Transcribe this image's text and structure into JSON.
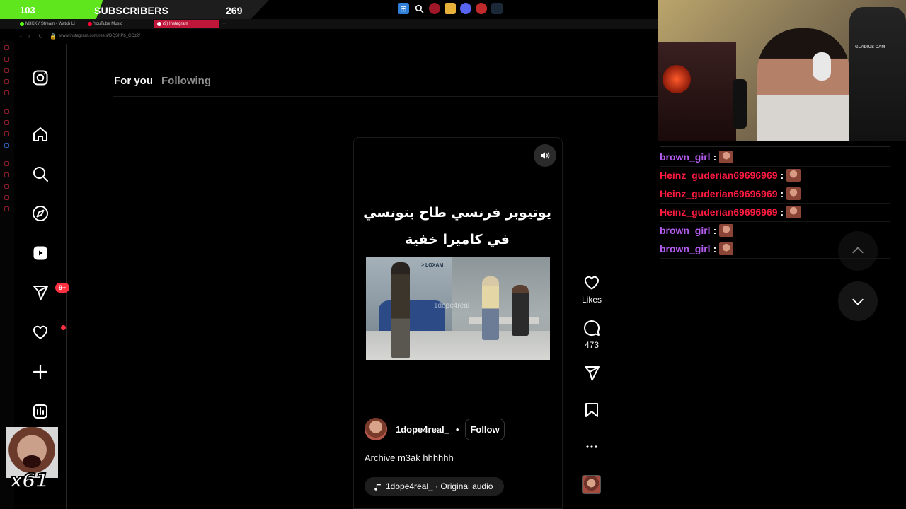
{
  "stream_overlay": {
    "subscribers": {
      "current": "103",
      "label": "SUBSCRIBERS",
      "goal": "269",
      "progress_fraction": 0.383
    },
    "emote_combo": "x61"
  },
  "browser": {
    "tabs": [
      {
        "label": "M3KKY Stream - Watch Li",
        "color": "#53fc18"
      },
      {
        "label": "YouTube Music",
        "color": "#ff0033"
      },
      {
        "label": "(9) Instagram",
        "color": "#ffffff",
        "active": true
      }
    ],
    "url": "www.instagram.com/reels/DQShPb_COz2/"
  },
  "instagram": {
    "nav": {
      "items": [
        {
          "name": "instagram-logo-icon"
        },
        {
          "name": "home-icon"
        },
        {
          "name": "search-icon"
        },
        {
          "name": "explore-icon"
        },
        {
          "name": "reels-icon"
        },
        {
          "name": "messages-icon"
        },
        {
          "name": "notifications-icon"
        },
        {
          "name": "create-icon"
        },
        {
          "name": "dashboard-icon"
        }
      ],
      "messages_badge": "9+"
    },
    "tabs": {
      "for_you": "For you",
      "following": "Following"
    },
    "reel": {
      "caption_line1": "يوتيوبر فرنسي طاح بتونسي",
      "caption_line2": "في كاميرا خفية",
      "watermark": "1dope4real",
      "truck_brand": "> LOXAM",
      "author": "1dope4real_",
      "separator": "•",
      "follow_label": "Follow",
      "description": "Archive m3ak hhhhhh",
      "audio": "1dope4real_ · Original audio",
      "likes_label": "Likes",
      "comments_count": "473"
    }
  },
  "chat": {
    "messages": [
      {
        "user": "brown_girl",
        "color": "#b45cf0"
      },
      {
        "user": "Heinz_guderian69696969",
        "color": "#ff1a40"
      },
      {
        "user": "Heinz_guderian69696969",
        "color": "#ff1a40"
      },
      {
        "user": "Heinz_guderian69696969",
        "color": "#ff1a40"
      },
      {
        "user": "brown_girl",
        "color": "#b45cf0"
      },
      {
        "user": "brown_girl",
        "color": "#b45cf0"
      }
    ],
    "separator": ":"
  },
  "webcam": {
    "chair_label": "GLADIUS CAM"
  }
}
